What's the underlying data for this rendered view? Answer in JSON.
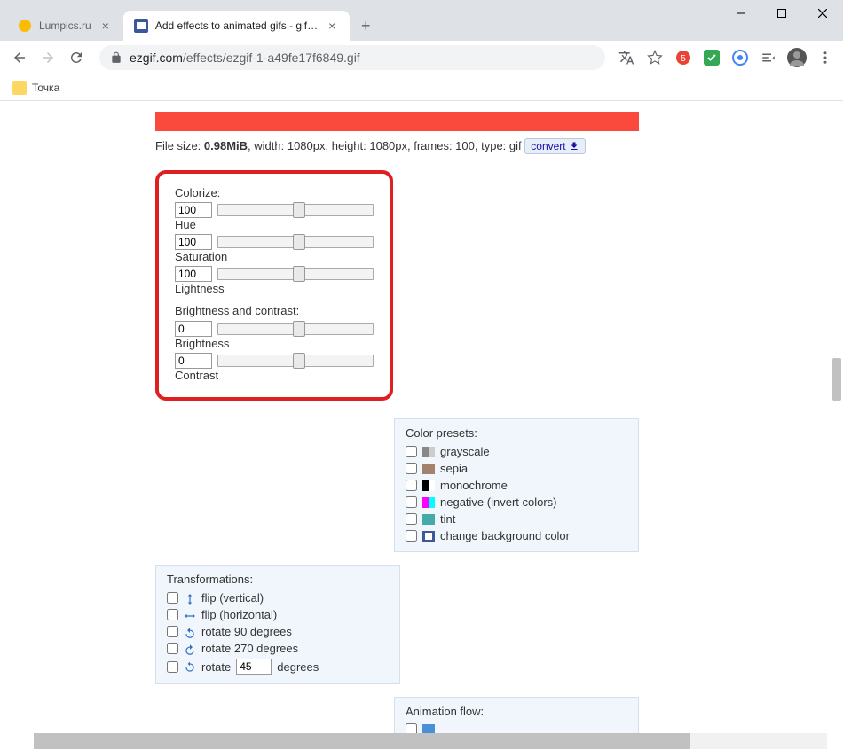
{
  "tabs": [
    {
      "label": "Lumpics.ru",
      "active": false
    },
    {
      "label": "Add effects to animated gifs - gif…",
      "active": true
    }
  ],
  "url": {
    "host": "ezgif.com",
    "path": "/effects/ezgif-1-a49fe17f6849.gif"
  },
  "bookmark": {
    "label": "Точка"
  },
  "file_info": {
    "prefix": "File size: ",
    "size": "0.98MiB",
    "rest": ", width: 1080px, height: 1080px, frames: 100, type: gif",
    "convert": "convert"
  },
  "colorize": {
    "header": "Colorize:",
    "hue": {
      "label": "Hue",
      "value": "100"
    },
    "sat": {
      "label": "Saturation",
      "value": "100"
    },
    "light": {
      "label": "Lightness",
      "value": "100"
    },
    "bc_header": "Brightness and contrast:",
    "brightness": {
      "label": "Brightness",
      "value": "0"
    },
    "contrast": {
      "label": "Contrast",
      "value": "0"
    }
  },
  "presets": {
    "title": "Color presets:",
    "items": [
      "grayscale",
      "sepia",
      "monochrome",
      "negative (invert colors)",
      "tint",
      "change background color"
    ]
  },
  "transforms": {
    "title": "Transformations:",
    "flip_v": "flip (vertical)",
    "flip_h": "flip (horizontal)",
    "rot90": "rotate 90 degrees",
    "rot270": "rotate 270 degrees",
    "rot_custom_prefix": "rotate",
    "rot_custom_value": "45",
    "rot_custom_suffix": "degrees"
  },
  "animflow": {
    "title": "Animation flow:"
  }
}
